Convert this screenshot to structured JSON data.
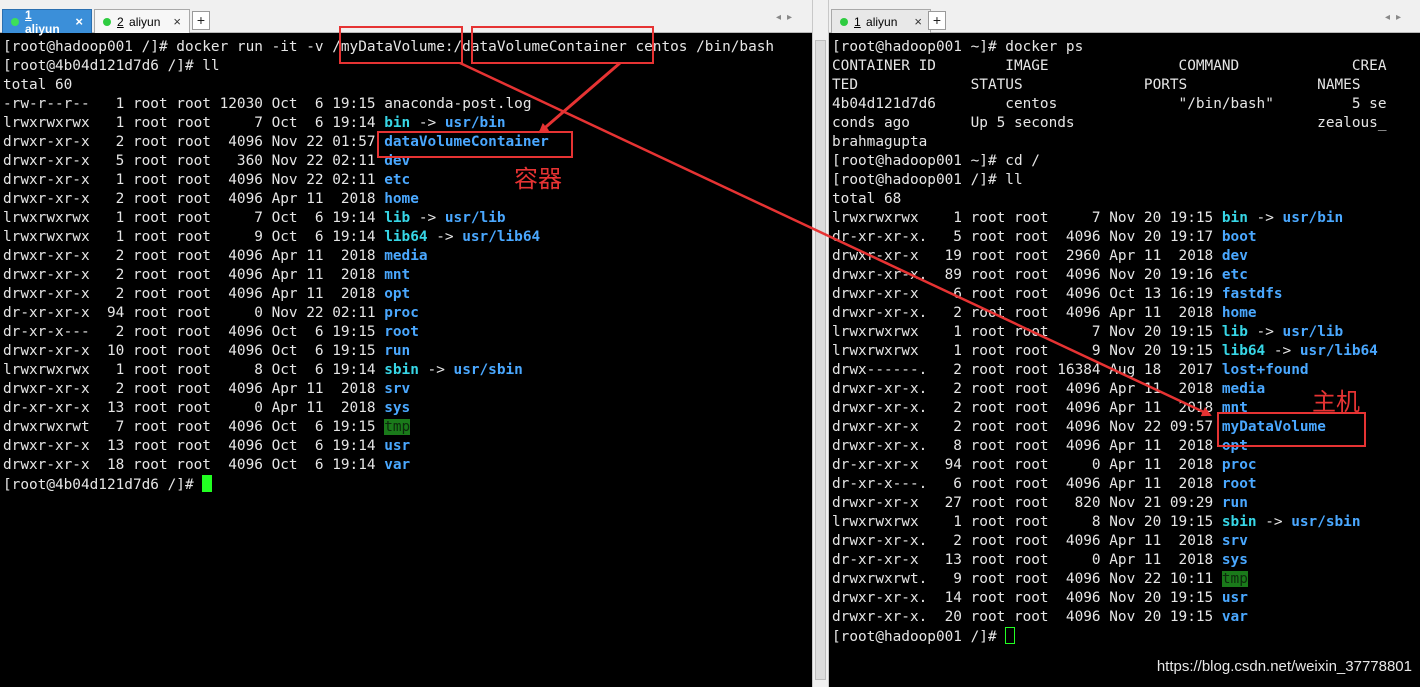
{
  "left": {
    "tabs": [
      {
        "num": "1",
        "name": " aliyun",
        "active": true
      },
      {
        "num": "2",
        "name": " aliyun",
        "active": false
      }
    ],
    "lines": [
      {
        "text": "[root@hadoop001 /]# docker run -it -v /myDataVolume:/dataVolumeContainer centos /bin/bash"
      },
      {
        "text": "[root@4b04d121d7d6 /]# ll"
      },
      {
        "text": "total 60"
      },
      {
        "perm": "-rw-r--r--   1 root root 12030 Oct  6 19:15 ",
        "name": "anaconda-post.log",
        "kind": "file"
      },
      {
        "perm": "lrwxrwxrwx   1 root root     7 Oct  6 19:14 ",
        "name": "bin",
        "kind": "lnk",
        "arrow": " -> ",
        "target": "usr/bin"
      },
      {
        "perm": "drwxr-xr-x   2 root root  4096 Nov 22 01:57 ",
        "name": "dataVolumeContainer",
        "kind": "dir"
      },
      {
        "perm": "drwxr-xr-x   5 root root   360 Nov 22 02:11 ",
        "name": "dev",
        "kind": "dir"
      },
      {
        "perm": "drwxr-xr-x   1 root root  4096 Nov 22 02:11 ",
        "name": "etc",
        "kind": "dir"
      },
      {
        "perm": "drwxr-xr-x   2 root root  4096 Apr 11  2018 ",
        "name": "home",
        "kind": "dir"
      },
      {
        "perm": "lrwxrwxrwx   1 root root     7 Oct  6 19:14 ",
        "name": "lib",
        "kind": "lnk",
        "arrow": " -> ",
        "target": "usr/lib"
      },
      {
        "perm": "lrwxrwxrwx   1 root root     9 Oct  6 19:14 ",
        "name": "lib64",
        "kind": "lnk",
        "arrow": " -> ",
        "target": "usr/lib64"
      },
      {
        "perm": "drwxr-xr-x   2 root root  4096 Apr 11  2018 ",
        "name": "media",
        "kind": "dir"
      },
      {
        "perm": "drwxr-xr-x   2 root root  4096 Apr 11  2018 ",
        "name": "mnt",
        "kind": "dir"
      },
      {
        "perm": "drwxr-xr-x   2 root root  4096 Apr 11  2018 ",
        "name": "opt",
        "kind": "dir"
      },
      {
        "perm": "dr-xr-xr-x  94 root root     0 Nov 22 02:11 ",
        "name": "proc",
        "kind": "dir"
      },
      {
        "perm": "dr-xr-x---   2 root root  4096 Oct  6 19:15 ",
        "name": "root",
        "kind": "dir"
      },
      {
        "perm": "drwxr-xr-x  10 root root  4096 Oct  6 19:15 ",
        "name": "run",
        "kind": "dir"
      },
      {
        "perm": "lrwxrwxrwx   1 root root     8 Oct  6 19:14 ",
        "name": "sbin",
        "kind": "lnk",
        "arrow": " -> ",
        "target": "usr/sbin"
      },
      {
        "perm": "drwxr-xr-x   2 root root  4096 Apr 11  2018 ",
        "name": "srv",
        "kind": "dir"
      },
      {
        "perm": "dr-xr-xr-x  13 root root     0 Apr 11  2018 ",
        "name": "sys",
        "kind": "dir"
      },
      {
        "perm": "drwxrwxrwt   7 root root  4096 Oct  6 19:15 ",
        "name": "tmp",
        "kind": "tmp"
      },
      {
        "perm": "drwxr-xr-x  13 root root  4096 Oct  6 19:14 ",
        "name": "usr",
        "kind": "dir"
      },
      {
        "perm": "drwxr-xr-x  18 root root  4096 Oct  6 19:14 ",
        "name": "var",
        "kind": "dir"
      },
      {
        "text": "[root@4b04d121d7d6 /]# ",
        "cursor": "solid"
      }
    ],
    "annotation_label": "容器"
  },
  "right": {
    "tabs": [
      {
        "num": "1",
        "name": " aliyun",
        "active": false
      }
    ],
    "lines": [
      {
        "text": "[root@hadoop001 ~]# docker ps"
      },
      {
        "text": "CONTAINER ID        IMAGE               COMMAND             CREA"
      },
      {
        "text": "TED             STATUS              PORTS               NAMES"
      },
      {
        "text": "4b04d121d7d6        centos              \"/bin/bash\"         5 se"
      },
      {
        "text": "conds ago       Up 5 seconds                            zealous_"
      },
      {
        "text": "brahmagupta"
      },
      {
        "text": "[root@hadoop001 ~]# cd /"
      },
      {
        "text": "[root@hadoop001 /]# ll"
      },
      {
        "text": "total 68"
      },
      {
        "perm": "lrwxrwxrwx    1 root root     7 Nov 20 19:15 ",
        "name": "bin",
        "kind": "lnk",
        "arrow": " -> ",
        "target": "usr/bin"
      },
      {
        "perm": "dr-xr-xr-x.   5 root root  4096 Nov 20 19:17 ",
        "name": "boot",
        "kind": "dir"
      },
      {
        "perm": "drwxr-xr-x   19 root root  2960 Apr 11  2018 ",
        "name": "dev",
        "kind": "dir"
      },
      {
        "perm": "drwxr-xr-x.  89 root root  4096 Nov 20 19:16 ",
        "name": "etc",
        "kind": "dir"
      },
      {
        "perm": "drwxr-xr-x    6 root root  4096 Oct 13 16:19 ",
        "name": "fastdfs",
        "kind": "dir"
      },
      {
        "perm": "drwxr-xr-x.   2 root root  4096 Apr 11  2018 ",
        "name": "home",
        "kind": "dir"
      },
      {
        "perm": "lrwxrwxrwx    1 root root     7 Nov 20 19:15 ",
        "name": "lib",
        "kind": "lnk",
        "arrow": " -> ",
        "target": "usr/lib"
      },
      {
        "perm": "lrwxrwxrwx    1 root root     9 Nov 20 19:15 ",
        "name": "lib64",
        "kind": "lnk",
        "arrow": " -> ",
        "target": "usr/lib64"
      },
      {
        "perm": "drwx------.   2 root root 16384 Aug 18  2017 ",
        "name": "lost+found",
        "kind": "dir"
      },
      {
        "perm": "drwxr-xr-x.   2 root root  4096 Apr 11  2018 ",
        "name": "media",
        "kind": "dir"
      },
      {
        "perm": "drwxr-xr-x.   2 root root  4096 Apr 11  2018 ",
        "name": "mnt",
        "kind": "dir"
      },
      {
        "perm": "drwxr-xr-x    2 root root  4096 Nov 22 09:57 ",
        "name": "myDataVolume",
        "kind": "dir"
      },
      {
        "perm": "drwxr-xr-x.   8 root root  4096 Apr 11  2018 ",
        "name": "opt",
        "kind": "dir"
      },
      {
        "perm": "dr-xr-xr-x   94 root root     0 Apr 11  2018 ",
        "name": "proc",
        "kind": "dir"
      },
      {
        "perm": "dr-xr-x---.   6 root root  4096 Apr 11  2018 ",
        "name": "root",
        "kind": "dir"
      },
      {
        "perm": "drwxr-xr-x   27 root root   820 Nov 21 09:29 ",
        "name": "run",
        "kind": "dir"
      },
      {
        "perm": "lrwxrwxrwx    1 root root     8 Nov 20 19:15 ",
        "name": "sbin",
        "kind": "lnk",
        "arrow": " -> ",
        "target": "usr/sbin"
      },
      {
        "perm": "drwxr-xr-x.   2 root root  4096 Apr 11  2018 ",
        "name": "srv",
        "kind": "dir"
      },
      {
        "perm": "dr-xr-xr-x   13 root root     0 Apr 11  2018 ",
        "name": "sys",
        "kind": "dir"
      },
      {
        "perm": "drwxrwxrwt.   9 root root  4096 Nov 22 10:11 ",
        "name": "tmp",
        "kind": "tmp"
      },
      {
        "perm": "drwxr-xr-x.  14 root root  4096 Nov 20 19:15 ",
        "name": "usr",
        "kind": "dir"
      },
      {
        "perm": "drwxr-xr-x.  20 root root  4096 Nov 20 19:15 ",
        "name": "var",
        "kind": "dir"
      },
      {
        "text": "[root@hadoop001 /]# ",
        "cursor": "hollow"
      }
    ],
    "annotation_label": "主机"
  },
  "watermark": "https://blog.csdn.net/weixin_37778801",
  "colors": {
    "annotation": "#e63333",
    "dir": "#4aa8ff",
    "link": "#37d6e6",
    "cursor": "#22ff22"
  }
}
